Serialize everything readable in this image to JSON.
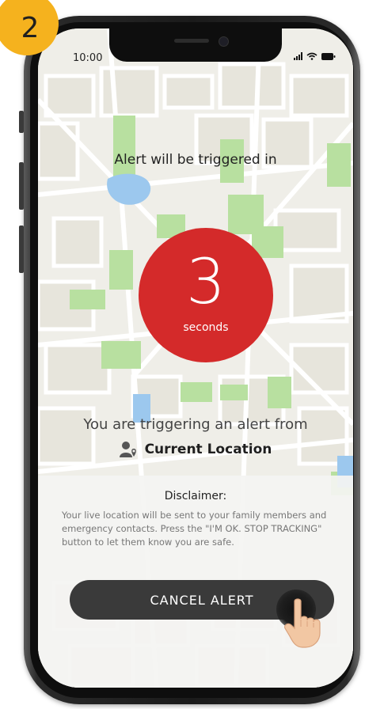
{
  "step": {
    "number": "2"
  },
  "status_bar": {
    "time": "10:00"
  },
  "alert": {
    "heading": "Alert will be triggered in",
    "countdown_value": "3",
    "countdown_unit": "seconds"
  },
  "trigger": {
    "text": "You are triggering an alert from",
    "location_label": "Current Location"
  },
  "disclaimer": {
    "title": "Disclaimer:",
    "body": "Your live location will be sent to your family members and emergency contacts. Press the \"I'M OK. STOP TRACKING\" button to let them know you are safe."
  },
  "actions": {
    "cancel_label": "CANCEL ALERT"
  },
  "colors": {
    "badge": "#f5b21e",
    "countdown": "#d42a2a",
    "button": "#3a3a3a",
    "map_park": "#b8e0a0",
    "map_water": "#9cc8ee"
  }
}
